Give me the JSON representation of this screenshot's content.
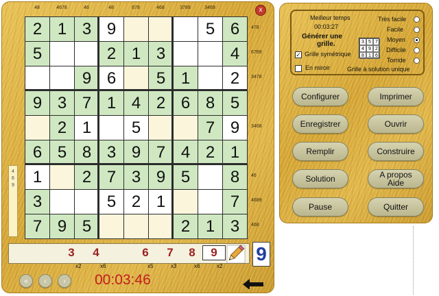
{
  "col_hints": [
    "48",
    "4678",
    "46",
    "48",
    "678",
    "468",
    "3789",
    "3469",
    ""
  ],
  "row_hints": [
    "478",
    "6789",
    "3478",
    "",
    "3468",
    "",
    "46",
    "4689",
    "468"
  ],
  "left_side_hint": [
    "4",
    "6",
    "9"
  ],
  "close_label": "x",
  "grid": [
    [
      "2",
      "1",
      "3",
      "9",
      "",
      "",
      "",
      "5",
      "6"
    ],
    [
      "5",
      "",
      "",
      "2",
      "1",
      "3",
      "",
      "",
      "4"
    ],
    [
      "",
      "",
      "9",
      "6",
      "",
      "5",
      "1",
      "",
      "2"
    ],
    [
      "9",
      "3",
      "7",
      "1",
      "4",
      "2",
      "6",
      "8",
      "5"
    ],
    [
      "",
      "2",
      "1",
      "",
      "5",
      "",
      "",
      "7",
      "9"
    ],
    [
      "6",
      "5",
      "8",
      "3",
      "9",
      "7",
      "4",
      "2",
      "1"
    ],
    [
      "1",
      "",
      "2",
      "7",
      "3",
      "9",
      "5",
      "",
      "8"
    ],
    [
      "3",
      "",
      "",
      "5",
      "2",
      "1",
      "",
      "",
      "7"
    ],
    [
      "7",
      "9",
      "5",
      "",
      "",
      "",
      "2",
      "1",
      "3"
    ]
  ],
  "grid_colors": [
    [
      "g",
      "g",
      "g",
      "w",
      "c",
      "c",
      "w",
      "w",
      "g"
    ],
    [
      "g",
      "w",
      "w",
      "g",
      "g",
      "g",
      "w",
      "w",
      "g"
    ],
    [
      "w",
      "w",
      "g",
      "w",
      "c",
      "g",
      "g",
      "w",
      "w"
    ],
    [
      "g",
      "g",
      "g",
      "g",
      "g",
      "g",
      "g",
      "g",
      "g"
    ],
    [
      "c",
      "g",
      "w",
      "w",
      "w",
      "c",
      "c",
      "g",
      "w"
    ],
    [
      "g",
      "g",
      "g",
      "g",
      "g",
      "g",
      "g",
      "g",
      "g"
    ],
    [
      "w",
      "c",
      "g",
      "g",
      "g",
      "g",
      "g",
      "w",
      "g"
    ],
    [
      "g",
      "w",
      "w",
      "w",
      "w",
      "w",
      "c",
      "w",
      "g"
    ],
    [
      "g",
      "g",
      "g",
      "c",
      "c",
      "c",
      "g",
      "g",
      "g"
    ]
  ],
  "number_bar": {
    "digits": [
      "",
      "",
      "3",
      "4",
      "",
      "6",
      "7",
      "8",
      "9"
    ],
    "counts": [
      "x2",
      "x6",
      "",
      "x5",
      "x3",
      "x6",
      "x2"
    ],
    "selected_digit": "9"
  },
  "timer": "00:03:46",
  "info": {
    "best_time_label": "Meilleur temps",
    "best_time_value": "00:03:27",
    "generate_label_1": "Générer une",
    "generate_label_2": "grille.",
    "symmetric_label": "Grille symétrique",
    "mirror_label": "En miroir",
    "unique_label": "Grille à solution unique",
    "mini_grid": [
      "3",
      "5",
      "7",
      "4",
      "9",
      "2",
      "8",
      "1",
      "6"
    ],
    "difficulties": [
      "Très facile",
      "Facile",
      "Moyen",
      "Difficile",
      "Torride"
    ],
    "selected_difficulty": "Moyen"
  },
  "buttons": {
    "configurer": "Configurer",
    "imprimer": "Imprimer",
    "enregistrer": "Enregistrer",
    "ouvrir": "Ouvrir",
    "remplir": "Remplir",
    "construire": "Construire",
    "solution": "Solution",
    "apropos_1": "A propos",
    "apropos_2": "Aide",
    "pause": "Pause",
    "quitter": "Quitter"
  },
  "nav": {
    "first": "«",
    "prev": "‹",
    "next": "›"
  },
  "colors": {
    "green_cell": "#cfe8c1",
    "cream_cell": "#fbf6db",
    "timer": "#c01e1e",
    "big_digit": "#1f3fa0"
  }
}
